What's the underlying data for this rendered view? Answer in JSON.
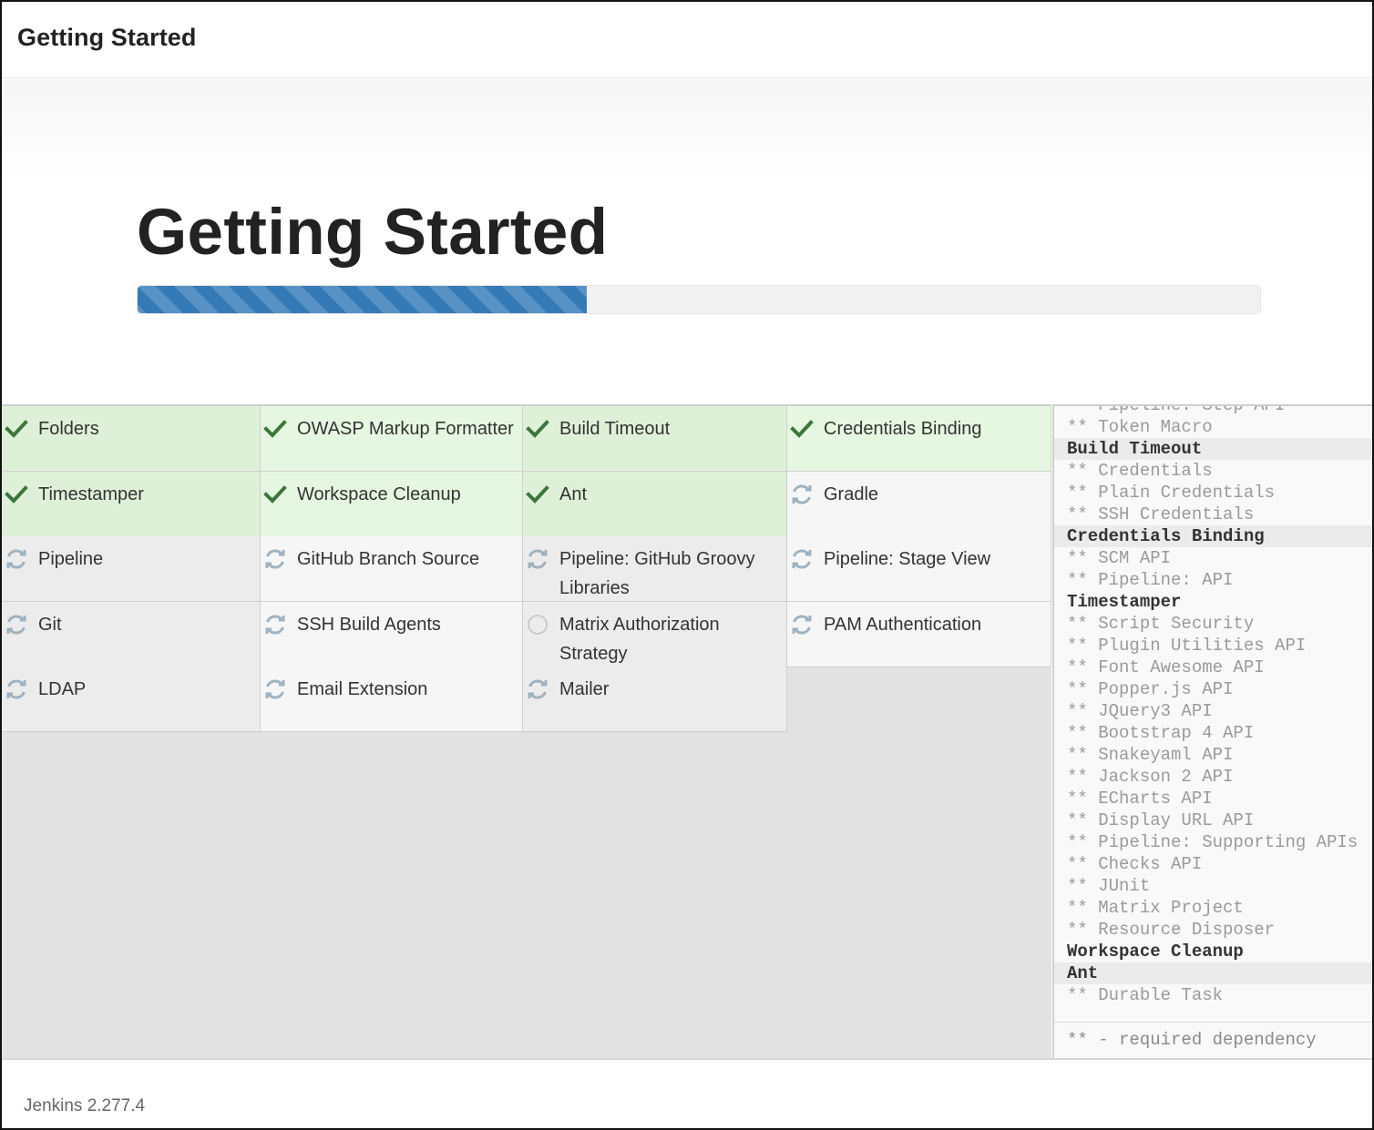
{
  "header": {
    "title": "Getting Started"
  },
  "hero": {
    "title": "Getting Started",
    "progress_percent": 40,
    "progress_color": "#337ab7"
  },
  "plugins": [
    {
      "label": "Folders",
      "status": "done",
      "icon": "check-icon"
    },
    {
      "label": "OWASP Markup Formatter",
      "status": "done",
      "icon": "check-icon"
    },
    {
      "label": "Build Timeout",
      "status": "done",
      "icon": "check-icon"
    },
    {
      "label": "Credentials Binding",
      "status": "done",
      "icon": "check-icon"
    },
    {
      "label": "Timestamper",
      "status": "done",
      "icon": "check-icon"
    },
    {
      "label": "Workspace Cleanup",
      "status": "done",
      "icon": "check-icon"
    },
    {
      "label": "Ant",
      "status": "done",
      "icon": "check-icon"
    },
    {
      "label": "Gradle",
      "status": "installing",
      "icon": "refresh-icon"
    },
    {
      "label": "Pipeline",
      "status": "installing",
      "icon": "refresh-icon"
    },
    {
      "label": "GitHub Branch Source",
      "status": "installing",
      "icon": "refresh-icon"
    },
    {
      "label": "Pipeline: GitHub Groovy Libraries",
      "status": "installing",
      "icon": "refresh-icon"
    },
    {
      "label": "Pipeline: Stage View",
      "status": "installing",
      "icon": "refresh-icon"
    },
    {
      "label": "Git",
      "status": "installing",
      "icon": "refresh-icon"
    },
    {
      "label": "SSH Build Agents",
      "status": "installing",
      "icon": "refresh-icon"
    },
    {
      "label": "Matrix Authorization Strategy",
      "status": "pending",
      "icon": "circle-icon"
    },
    {
      "label": "PAM Authentication",
      "status": "installing",
      "icon": "refresh-icon"
    },
    {
      "label": "LDAP",
      "status": "installing",
      "icon": "refresh-icon"
    },
    {
      "label": "Email Extension",
      "status": "installing",
      "icon": "refresh-icon"
    },
    {
      "label": "Mailer",
      "status": "installing",
      "icon": "refresh-icon"
    }
  ],
  "install_log": {
    "lines": [
      {
        "text": "** Pipeline: Step API",
        "type": "dep"
      },
      {
        "text": "** Token Macro",
        "type": "dep"
      },
      {
        "text": "Build Timeout",
        "type": "head",
        "shade": true
      },
      {
        "text": "** Credentials",
        "type": "dep"
      },
      {
        "text": "** Plain Credentials",
        "type": "dep"
      },
      {
        "text": "** SSH Credentials",
        "type": "dep"
      },
      {
        "text": "Credentials Binding",
        "type": "head",
        "shade": true
      },
      {
        "text": "** SCM API",
        "type": "dep"
      },
      {
        "text": "** Pipeline: API",
        "type": "dep"
      },
      {
        "text": "Timestamper",
        "type": "head"
      },
      {
        "text": "** Script Security",
        "type": "dep"
      },
      {
        "text": "** Plugin Utilities API",
        "type": "dep"
      },
      {
        "text": "** Font Awesome API",
        "type": "dep"
      },
      {
        "text": "** Popper.js API",
        "type": "dep"
      },
      {
        "text": "** JQuery3 API",
        "type": "dep"
      },
      {
        "text": "** Bootstrap 4 API",
        "type": "dep"
      },
      {
        "text": "** Snakeyaml API",
        "type": "dep"
      },
      {
        "text": "** Jackson 2 API",
        "type": "dep"
      },
      {
        "text": "** ECharts API",
        "type": "dep"
      },
      {
        "text": "** Display URL API",
        "type": "dep"
      },
      {
        "text": "** Pipeline: Supporting APIs",
        "type": "dep"
      },
      {
        "text": "** Checks API",
        "type": "dep"
      },
      {
        "text": "** JUnit",
        "type": "dep"
      },
      {
        "text": "** Matrix Project",
        "type": "dep"
      },
      {
        "text": "** Resource Disposer",
        "type": "dep"
      },
      {
        "text": "Workspace Cleanup",
        "type": "head"
      },
      {
        "text": "Ant",
        "type": "head",
        "shade": true
      },
      {
        "text": "** Durable Task",
        "type": "dep"
      }
    ],
    "footer": "** - required dependency"
  },
  "footer": {
    "version": "Jenkins 2.277.4"
  },
  "colors": {
    "done_bg": "#dff0d8",
    "check": "#3c763d",
    "spinner": "#9fb2bf"
  }
}
